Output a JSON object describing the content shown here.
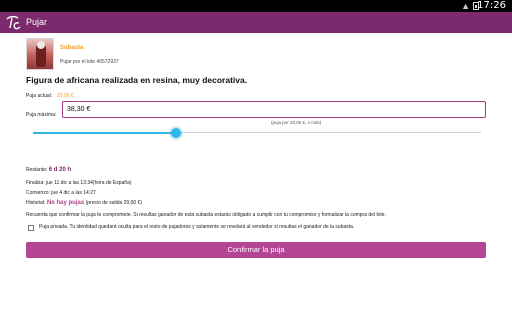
{
  "status_bar": {
    "time": "17:26"
  },
  "action_bar": {
    "title": "Pujar",
    "logo_icon": "tc-logo"
  },
  "item": {
    "category": "Subasta",
    "lot_text": "Pujar por el lote 46572937",
    "title": "Figura de africana realizada en resina, muy decorativa."
  },
  "bid": {
    "current_label": "Puja actual:",
    "current_value": "29,00 €",
    "max_label": "Puja máxima:",
    "max_value": "38,30 €",
    "hint": "(puja por 29,00 €, o más)",
    "slider_fraction": 0.32
  },
  "details": {
    "remaining_label": "Restante:",
    "remaining_value": "6 d 20 h",
    "ends_label": "Finaliza:",
    "ends_value": "jue 11 dic a las 13:34(hora de España)",
    "start_label": "Comienzo:",
    "start_value": "jue 4 dic a las 14:27",
    "history_label": "Historial:",
    "history_value": "No hay pujas",
    "history_note": "(precio de salida 29,00 €)"
  },
  "notice": "Recuerda que confirmar la puja te compromete. Si resultas ganador de esta subasta estarás obligado a cumplir con tu compromiso y formalizar la compra del lote.",
  "private_bid": {
    "checked": false,
    "text": "Puja privada. Tu identidad quedará oculta para el resto de pujadores y solamente se revelará al vendedor si resultas el ganador de la subasta."
  },
  "confirm_label": "Confirmar la puja",
  "colors": {
    "brand": "#7b2a6e",
    "accent": "#b34496",
    "orange": "#f29b1e",
    "slider": "#33b5e5"
  }
}
